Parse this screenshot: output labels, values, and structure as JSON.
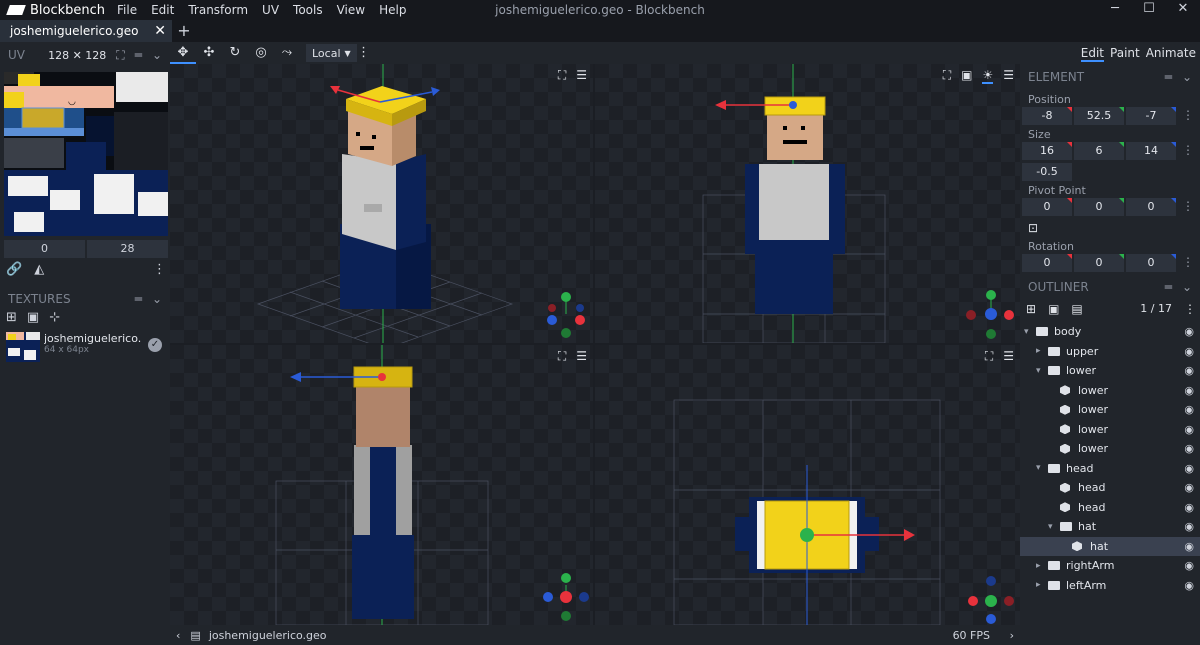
{
  "app": {
    "name": "Blockbench",
    "window_title": "joshemiguelerico.geo - Blockbench",
    "menu": [
      "File",
      "Edit",
      "Transform",
      "UV",
      "Tools",
      "View",
      "Help"
    ]
  },
  "tab": {
    "label": "joshemiguelerico.geo"
  },
  "uv": {
    "label": "UV",
    "size": "128 ✕ 128",
    "inputs": [
      "0",
      "28"
    ]
  },
  "textures": {
    "label": "TEXTURES",
    "item": {
      "name": "joshemiguelerico.png",
      "size": "64 x 64px"
    }
  },
  "toolbar": {
    "space_select": "Local"
  },
  "modes": [
    "Edit",
    "Paint",
    "Animate"
  ],
  "element": {
    "label": "ELEMENT",
    "position_label": "Position",
    "position": [
      "-8",
      "52.5",
      "-7"
    ],
    "size_label": "Size",
    "size": [
      "16",
      "6",
      "14"
    ],
    "inflate": "-0.5",
    "pivot_label": "Pivot Point",
    "pivot": [
      "0",
      "0",
      "0"
    ],
    "rotation_label": "Rotation",
    "rotation": [
      "0",
      "0",
      "0"
    ]
  },
  "outliner": {
    "label": "OUTLINER",
    "count": "1 / 17",
    "items": [
      {
        "label": "body",
        "depth": 0,
        "kind": "folder",
        "arrow": "open"
      },
      {
        "label": "upper",
        "depth": 1,
        "kind": "folder",
        "arrow": "closed"
      },
      {
        "label": "lower",
        "depth": 1,
        "kind": "folder",
        "arrow": "open"
      },
      {
        "label": "lower",
        "depth": 2,
        "kind": "cube"
      },
      {
        "label": "lower",
        "depth": 2,
        "kind": "cube"
      },
      {
        "label": "lower",
        "depth": 2,
        "kind": "cube"
      },
      {
        "label": "lower",
        "depth": 2,
        "kind": "cube"
      },
      {
        "label": "head",
        "depth": 1,
        "kind": "folder",
        "arrow": "open"
      },
      {
        "label": "head",
        "depth": 2,
        "kind": "cube"
      },
      {
        "label": "head",
        "depth": 2,
        "kind": "cube"
      },
      {
        "label": "hat",
        "depth": 2,
        "kind": "folder",
        "arrow": "open"
      },
      {
        "label": "hat",
        "depth": 3,
        "kind": "cube",
        "selected": true
      },
      {
        "label": "rightArm",
        "depth": 1,
        "kind": "folder",
        "arrow": "closed"
      },
      {
        "label": "leftArm",
        "depth": 1,
        "kind": "folder",
        "arrow": "closed"
      }
    ]
  },
  "status": {
    "file": "joshemiguelerico.geo",
    "fps": "60 FPS"
  },
  "colors": {
    "accent": "#3e90ff",
    "x_axis": "#e8323c",
    "y_axis": "#2bb24c",
    "z_axis": "#2a5bd7"
  }
}
